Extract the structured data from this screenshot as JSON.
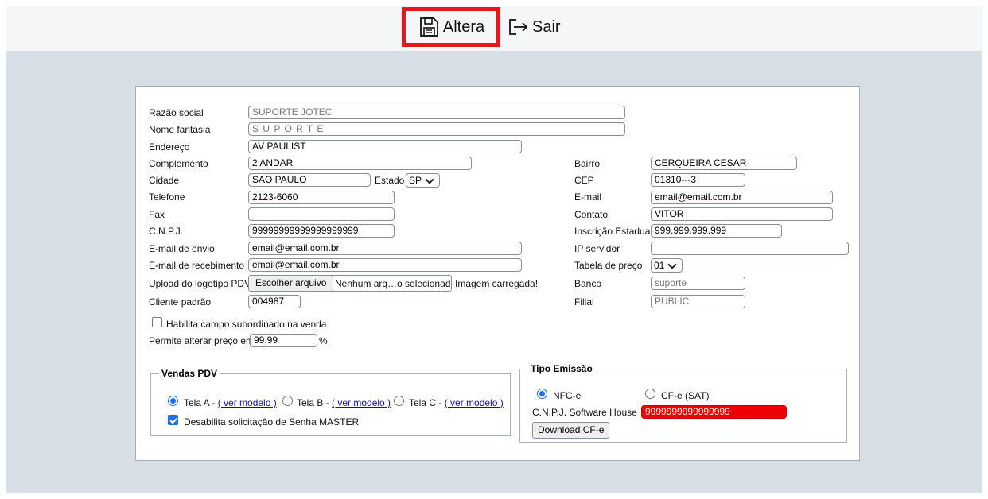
{
  "toolbar": {
    "altera_label": "Altera",
    "sair_label": "Sair"
  },
  "form": {
    "razao_social": {
      "label": "Razão social",
      "value": "SUPORTE  JOTEC"
    },
    "nome_fantasia": {
      "label": "Nome fantasia",
      "value": "S U P O R T E"
    },
    "endereco": {
      "label": "Endereço",
      "value": "AV PAULIST"
    },
    "complemento": {
      "label": "Complemento",
      "value": "2 ANDAR"
    },
    "cidade": {
      "label": "Cidade",
      "value": "SAO PAULO"
    },
    "estado": {
      "label": "Estado",
      "value": "SP"
    },
    "telefone": {
      "label": "Telefone",
      "value": "2123-6060"
    },
    "fax": {
      "label": "Fax",
      "value": ""
    },
    "cnpj": {
      "label": "C.N.P.J.",
      "value": "99999999999999999999"
    },
    "email_envio": {
      "label": "E-mail de envio",
      "value": "email@email.com.br"
    },
    "email_recebimento": {
      "label": "E-mail de recebimento",
      "value": "email@email.com.br"
    },
    "upload_logo": {
      "label": "Upload do logotipo PDV",
      "button": "Escolher arquivo",
      "file_status": "Nenhum arq…o selecionado",
      "image_status": "Imagem carregada!"
    },
    "cliente_padrao": {
      "label": "Cliente padrão",
      "value": "004987"
    },
    "bairro": {
      "label": "Bairro",
      "value": "CERQUEIRA CESAR"
    },
    "cep": {
      "label": "CEP",
      "value": "01310---3"
    },
    "email": {
      "label": "E-mail",
      "value": "email@email.com.br"
    },
    "contato": {
      "label": "Contato",
      "value": "VITOR"
    },
    "inscricao_estadual": {
      "label": "Inscrição Estadual",
      "value": "999.999.999.999"
    },
    "ip_servidor": {
      "label": "IP servidor",
      "value": ""
    },
    "tabela_preco": {
      "label": "Tabela de preço",
      "value": "01"
    },
    "banco": {
      "label": "Banco",
      "value": "suporte"
    },
    "filial": {
      "label": "Filial",
      "value": "PUBLIC"
    },
    "habilita_subordinado": {
      "label": "Habilita campo subordinado na venda",
      "checked": false
    },
    "permite_alterar_preco": {
      "label": "Permite alterar preço em",
      "value": "99,99",
      "suffix": "%"
    }
  },
  "vendas_pdv": {
    "legend": "Vendas PDV",
    "tela_a": "Tela A - ",
    "tela_b": "Tela B - ",
    "tela_c": "Tela C - ",
    "ver_modelo": "( ver modelo )",
    "selected": "Tela A",
    "desabilita_senha": "Desabilita solicitação de Senha MASTER"
  },
  "tipo_emissao": {
    "legend": "Tipo Emissão",
    "nfce": "NFC-e",
    "cfe_sat": "CF-e (SAT)",
    "selected": "NFC-e",
    "cnpj_sh_label": "C.N.P.J. Software House",
    "cnpj_sh_value": "9999999999999999",
    "download_label": "Download CF-e"
  },
  "colors": {
    "highlight_border": "#e8161d",
    "error_field": "#ee0000",
    "accent": "#1a73e8",
    "background": "#d7dee5"
  }
}
